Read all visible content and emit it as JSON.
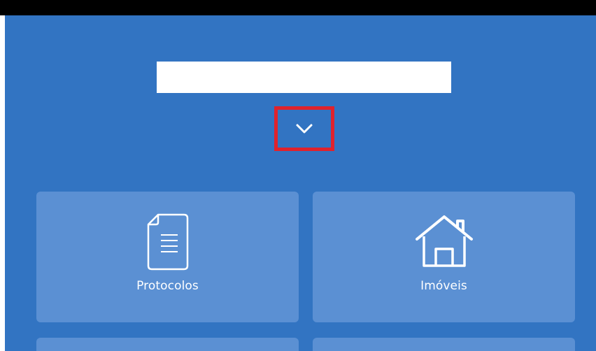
{
  "tiles": [
    {
      "label": "Protocolos",
      "icon": "document-icon"
    },
    {
      "label": "Imóveis",
      "icon": "house-icon"
    }
  ],
  "colors": {
    "app_background": "#3274c2",
    "tile_background": "#5b90d3",
    "highlight_border": "#e0222c",
    "top_bar": "#000000"
  }
}
